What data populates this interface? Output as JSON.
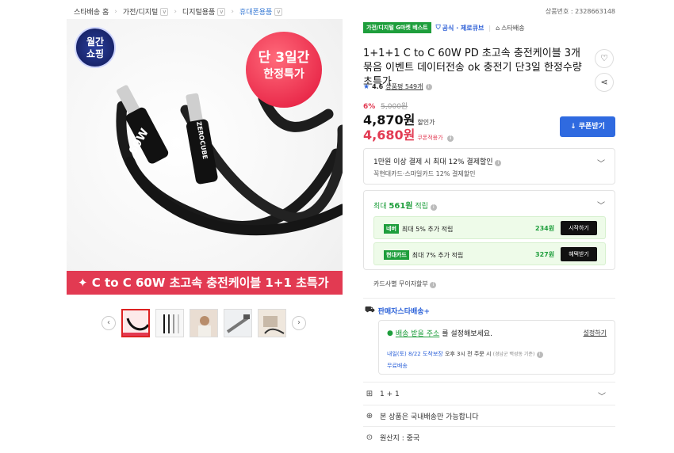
{
  "breadcrumb": {
    "items": [
      "스타배송 홈",
      "가전/디지털",
      "디지털용품",
      "휴대폰용품"
    ],
    "chevron": "v"
  },
  "product_number": "상품번호 : 2328663148",
  "hero": {
    "badge_monthly_line1": "월간",
    "badge_monthly_line2": "쇼핑",
    "badge_sale_line1": "단 3일간",
    "badge_sale_line2": "한정특가",
    "cable_label_left": "60W",
    "cable_label_right": "ZEROCUBE",
    "bottom_banner": "✦ C to C 60W 초고속 충전케이블 1+1 초특가"
  },
  "thumbnails": {
    "prev": "‹",
    "next": "›",
    "count": 5
  },
  "tags": {
    "best": "가전/디지털 G마켓 베스트",
    "official": "공식 · 제로큐브",
    "store": "스타배송"
  },
  "title": "1+1+1 C to C 60W PD 초고속 충전케이블 3개묶음 이벤트 데이터전송 ok 충전기 단3일 한정수량 초특가",
  "rating": {
    "score": "4.6",
    "reviews": "상품평 549개"
  },
  "price": {
    "discount_pct": "6%",
    "original": "5,000원",
    "sale": "4,870원",
    "sale_note": "할인가",
    "coupon": "4,680원",
    "coupon_note": "쿠폰적용가",
    "coupon_button": "↓ 쿠폰받기"
  },
  "card_discount": {
    "title": "1만원 이상 결제 시 최대 12% 결제할인",
    "subtitle": "꼭현대카드·스마일카드 12% 결제할인"
  },
  "rewards": {
    "title_prefix": "최대 ",
    "title_amount": "561원",
    "title_suffix": " 적립",
    "items": [
      {
        "chip": "네버",
        "text": "최대 5% 추가 적립",
        "amount": "234원",
        "button": "시작하기"
      },
      {
        "chip": "현대카드",
        "text": "최대 7% 추가 적립",
        "amount": "327원",
        "button": "혜택받기"
      }
    ]
  },
  "card_interest_free": "카드사별 무이자할부",
  "delivery": {
    "header": "판매자스타배송+",
    "address_link": "배송 받을 주소",
    "address_text": "를 설정해보세요.",
    "set_link": "설정하기",
    "eta_bold": "내일(토) 8/22 도착보장",
    "eta_text": "오후 3시 전 주문 시",
    "eta_note": "(경남군 백성동 기준)",
    "fee": "무료배송"
  },
  "options": {
    "bundle": "1 + 1",
    "domestic": "본 상품은 국내배송만 가능합니다",
    "origin": "원산지 : 중국"
  },
  "colors": {
    "accent_blue": "#2f6ae0",
    "sale_red": "#e23a52",
    "reward_green": "#1e9e3c"
  }
}
